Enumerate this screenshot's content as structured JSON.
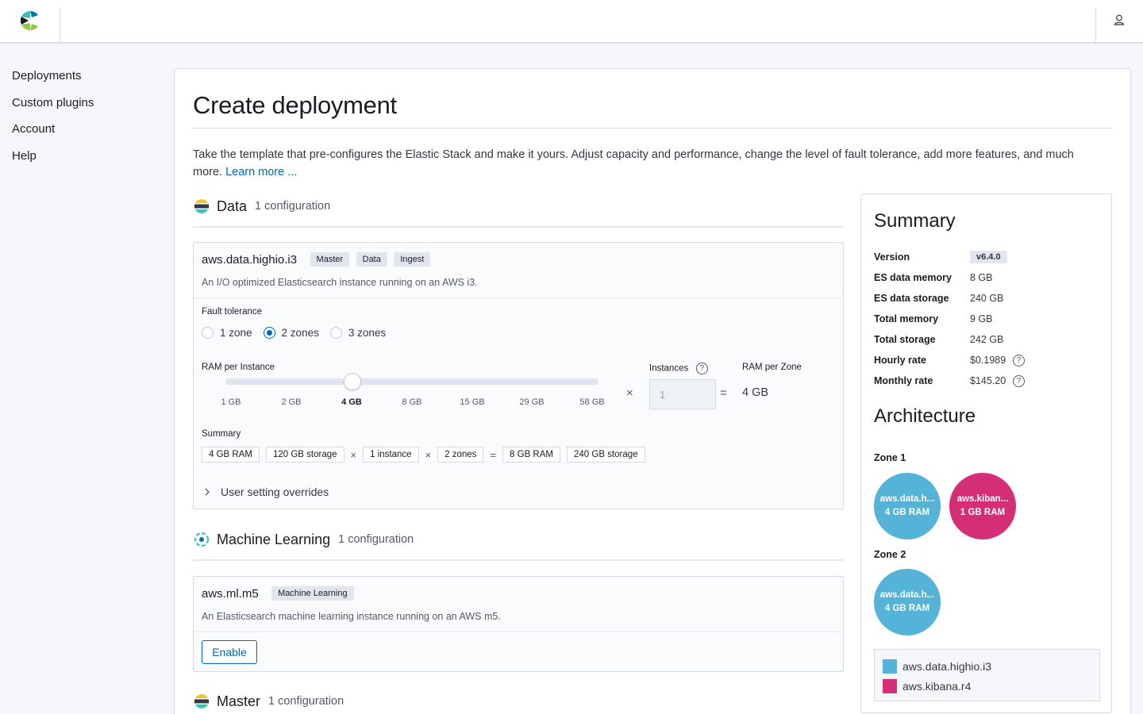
{
  "nav": {
    "items": [
      {
        "label": "Deployments"
      },
      {
        "label": "Custom plugins"
      },
      {
        "label": "Account"
      },
      {
        "label": "Help"
      }
    ]
  },
  "page": {
    "title": "Create deployment",
    "intro": "Take the template that pre-configures the Elastic Stack and make it yours. Adjust capacity and performance, change the level of fault tolerance, add more features, and much more. ",
    "learn_more": "Learn more ..."
  },
  "data_section": {
    "title": "Data",
    "subtitle": "1 configuration",
    "card": {
      "name": "aws.data.highio.i3",
      "badges": [
        "Master",
        "Data",
        "Ingest"
      ],
      "description": "An I/O optimized Elasticsearch instance running on an AWS i3.",
      "fault_tolerance_label": "Fault tolerance",
      "zones": [
        {
          "label": "1 zone",
          "checked": false
        },
        {
          "label": "2 zones",
          "checked": true
        },
        {
          "label": "3 zones",
          "checked": false
        }
      ],
      "ram_label": "RAM per Instance",
      "ram_ticks": [
        "1 GB",
        "2 GB",
        "4 GB",
        "8 GB",
        "15 GB",
        "29 GB",
        "58 GB"
      ],
      "ram_selected": "4 GB",
      "instances_label": "Instances",
      "instances_help": "?",
      "instances_value": "1",
      "ram_per_zone_label": "RAM per Zone",
      "ram_per_zone_value": "4 GB",
      "times_symbol": "×",
      "equals_symbol": "=",
      "summary_label": "Summary",
      "summary_chips": {
        "ram": "4 GB RAM",
        "storage": "120 GB storage",
        "instance": "1 instance",
        "zones": "2 zones",
        "total_ram": "8 GB RAM",
        "total_storage": "240 GB storage"
      },
      "overrides": "User setting overrides"
    }
  },
  "ml_section": {
    "title": "Machine Learning",
    "subtitle": "1 configuration",
    "card": {
      "name": "aws.ml.m5",
      "badges": [
        "Machine Learning"
      ],
      "description": "An Elasticsearch machine learning instance running on an AWS m5.",
      "enable": "Enable"
    }
  },
  "master_section": {
    "title": "Master",
    "subtitle": "1 configuration"
  },
  "summary": {
    "title": "Summary",
    "rows": [
      {
        "key": "Version",
        "value": "v6.4.0"
      },
      {
        "key": "ES data memory",
        "value": "8 GB"
      },
      {
        "key": "ES data storage",
        "value": "240 GB"
      },
      {
        "key": "Total memory",
        "value": "9 GB"
      },
      {
        "key": "Total storage",
        "value": "242 GB"
      },
      {
        "key": "Hourly rate",
        "value": "$0.1989"
      },
      {
        "key": "Monthly rate",
        "value": "$145.20"
      }
    ],
    "help": "?"
  },
  "architecture": {
    "title": "Architecture",
    "zone1": "Zone 1",
    "zone2": "Zone 2",
    "nodes": {
      "z1_data": {
        "name": "aws.data.h...",
        "ram": "4 GB RAM"
      },
      "z1_kibana": {
        "name": "aws.kiban...",
        "ram": "1 GB RAM"
      },
      "z2_data": {
        "name": "aws.data.h...",
        "ram": "4 GB RAM"
      }
    },
    "legend": [
      {
        "label": "aws.data.highio.i3",
        "color": "#54b3d6"
      },
      {
        "label": "aws.kibana.r4",
        "color": "#d42f76"
      }
    ]
  },
  "colors": {
    "accent": "#006bb4",
    "data_node": "#54b3d6",
    "kibana_node": "#d42f76"
  }
}
